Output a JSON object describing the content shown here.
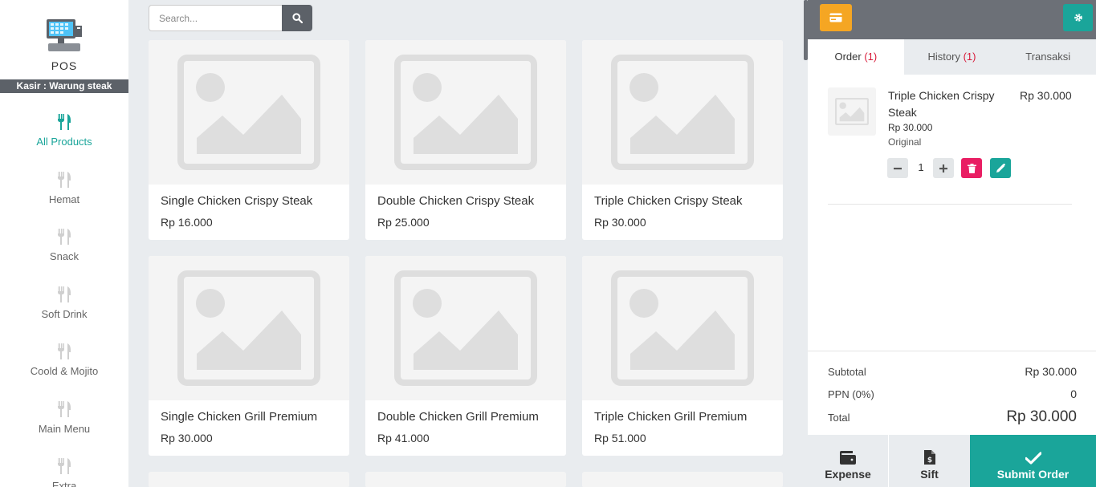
{
  "sidebar": {
    "app_name": "POS",
    "cashier": "Kasir : Warung steak",
    "categories": [
      {
        "label": "All Products",
        "active": true
      },
      {
        "label": "Hemat",
        "active": false
      },
      {
        "label": "Snack",
        "active": false
      },
      {
        "label": "Soft Drink",
        "active": false
      },
      {
        "label": "Coold & Mojito",
        "active": false
      },
      {
        "label": "Main Menu",
        "active": false
      },
      {
        "label": "Extra",
        "active": false
      }
    ]
  },
  "search": {
    "placeholder": "Search..."
  },
  "products": [
    {
      "name": "Single Chicken Crispy Steak",
      "price": "Rp 16.000"
    },
    {
      "name": "Double Chicken Crispy Steak",
      "price": "Rp 25.000"
    },
    {
      "name": "Triple Chicken Crispy Steak",
      "price": "Rp 30.000"
    },
    {
      "name": "Single Chicken Grill Premium",
      "price": "Rp 30.000"
    },
    {
      "name": "Double Chicken Grill Premium",
      "price": "Rp 41.000"
    },
    {
      "name": "Triple Chicken Grill Premium",
      "price": "Rp 51.000"
    }
  ],
  "panel": {
    "tabs": [
      {
        "label": "Order",
        "count": "(1)"
      },
      {
        "label": "History",
        "count": "(1)"
      },
      {
        "label": "Transaksi",
        "count": ""
      }
    ],
    "order_item": {
      "name": "Triple Chicken Crispy Steak",
      "total": "Rp 30.000",
      "price": "Rp 30.000",
      "variant": "Original",
      "qty": "1"
    },
    "summary": {
      "subtotal_label": "Subtotal",
      "subtotal": "Rp 30.000",
      "ppn_label": "PPN (0%)",
      "ppn": "0",
      "total_label": "Total",
      "total": "Rp 30.000"
    },
    "buttons": {
      "expense": "Expense",
      "sift": "Sift",
      "submit": "Submit Order"
    }
  },
  "colors": {
    "accent": "#1aa59a",
    "orange": "#f5a623",
    "danger": "#e91e63",
    "dark": "#6c7077"
  }
}
